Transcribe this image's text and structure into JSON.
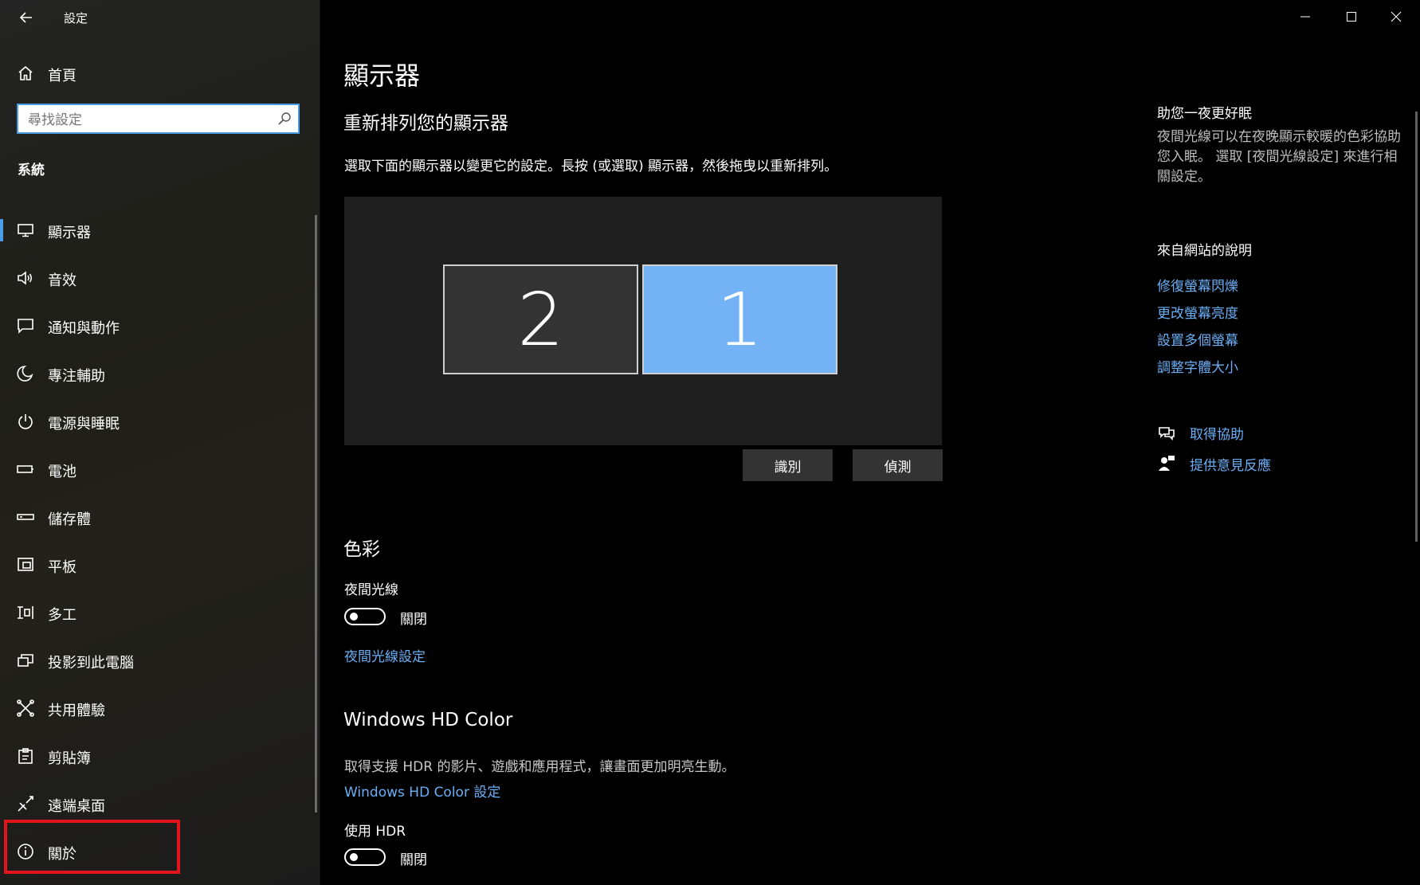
{
  "window": {
    "app_title": "設定",
    "controls": [
      "minimize-icon",
      "maximize-icon",
      "close-icon"
    ]
  },
  "sidebar": {
    "home_label": "首頁",
    "search_placeholder": "尋找設定",
    "section": "系統",
    "items": [
      {
        "label": "顯示器",
        "icon": "monitor-icon",
        "active": true
      },
      {
        "label": "音效",
        "icon": "speaker-icon"
      },
      {
        "label": "通知與動作",
        "icon": "notification-icon"
      },
      {
        "label": "專注輔助",
        "icon": "moon-icon"
      },
      {
        "label": "電源與睡眠",
        "icon": "power-icon"
      },
      {
        "label": "電池",
        "icon": "battery-icon"
      },
      {
        "label": "儲存體",
        "icon": "storage-icon"
      },
      {
        "label": "平板",
        "icon": "tablet-icon"
      },
      {
        "label": "多工",
        "icon": "multitask-icon"
      },
      {
        "label": "投影到此電腦",
        "icon": "project-icon"
      },
      {
        "label": "共用體驗",
        "icon": "shared-icon"
      },
      {
        "label": "剪貼簿",
        "icon": "clipboard-icon"
      },
      {
        "label": "遠端桌面",
        "icon": "remote-icon"
      },
      {
        "label": "關於",
        "icon": "info-icon"
      }
    ],
    "accent_color": "#4a9ee8",
    "highlight_color": "#e3141b"
  },
  "main": {
    "title": "顯示器",
    "rearrange_title": "重新排列您的顯示器",
    "rearrange_desc": "選取下面的顯示器以變更它的設定。長按 (或選取) 顯示器，然後拖曳以重新排列。",
    "monitors": [
      {
        "number": "2",
        "selected": false
      },
      {
        "number": "1",
        "selected": true
      }
    ],
    "identify_button": "識別",
    "detect_button": "偵測",
    "color_section": "色彩",
    "night_light_label": "夜間光線",
    "night_light_state": "關閉",
    "night_light_settings_link": "夜間光線設定",
    "hd_section": "Windows HD Color",
    "hd_desc": "取得支援 HDR 的影片、遊戲和應用程式，讓畫面更加明亮生動。",
    "hd_settings_link": "Windows HD Color 設定",
    "hdr_label": "使用 HDR",
    "hdr_state": "關閉",
    "selected_monitor_color": "#73b3f5",
    "link_color": "#6aaef5"
  },
  "right": {
    "sleep_title": "助您一夜更好眠",
    "sleep_text": "夜間光線可以在夜晚顯示較暖的色彩協助您入眠。 選取 [夜間光線設定] 來進行相關設定。",
    "web_help_title": "來自網站的說明",
    "web_links": [
      "修復螢幕閃爍",
      "更改螢幕亮度",
      "設置多個螢幕",
      "調整字體大小"
    ],
    "get_help": "取得協助",
    "feedback": "提供意見反應"
  }
}
